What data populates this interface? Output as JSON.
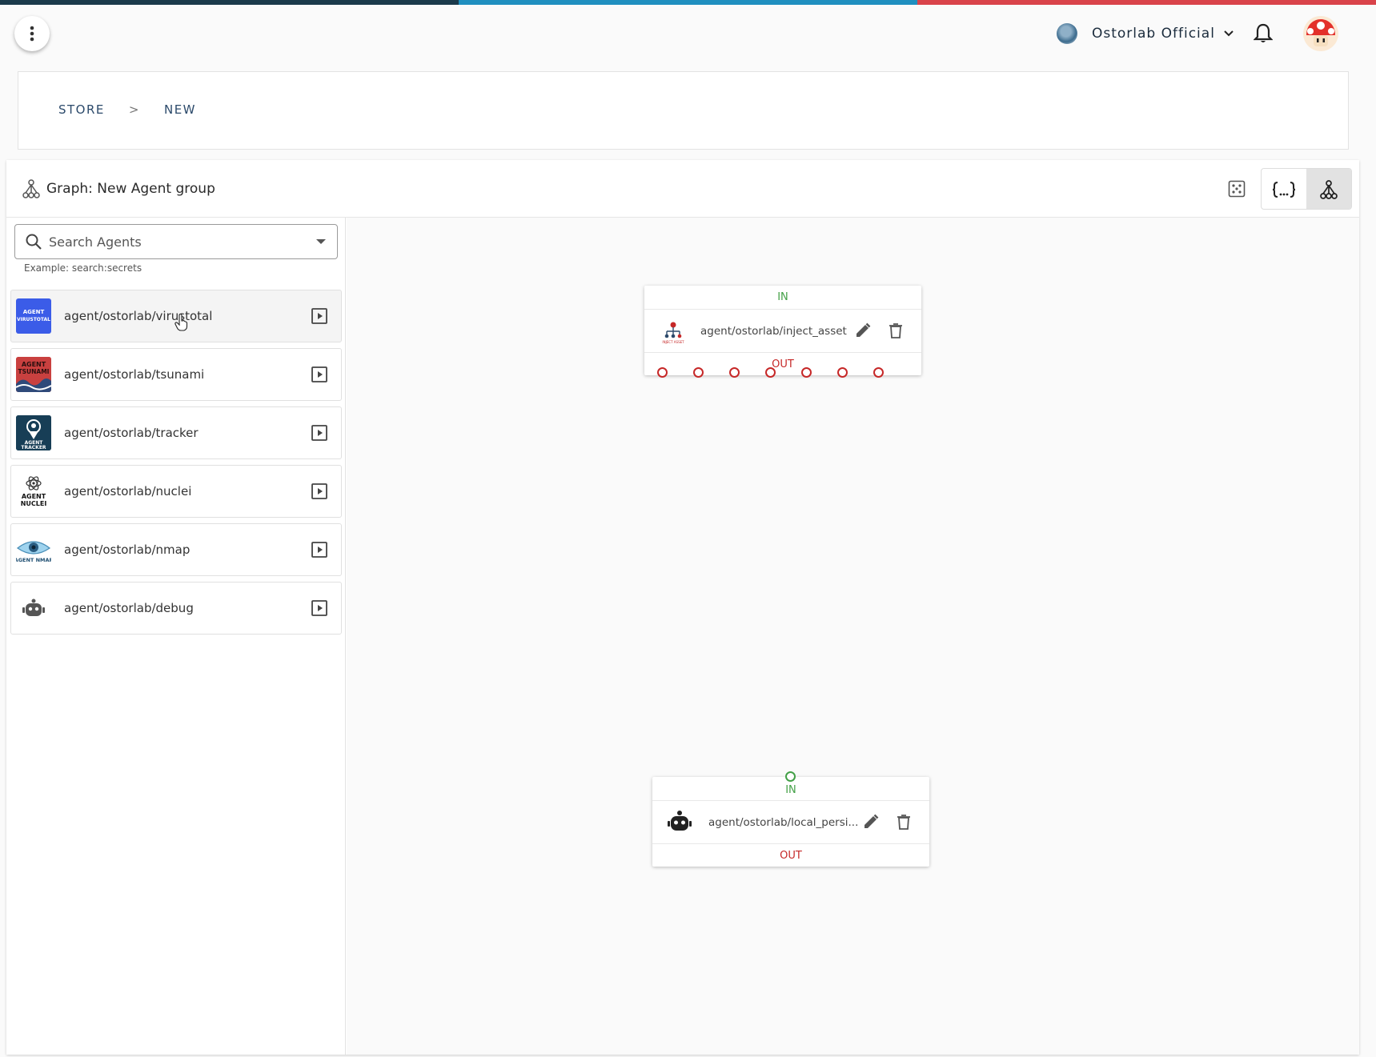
{
  "colors": {
    "strip": [
      "#1b3a4b",
      "#1f8fbf",
      "#d9434a"
    ],
    "in": "#43a047",
    "out": "#c62828"
  },
  "header": {
    "org_name": "Ostorlab Official",
    "menu_icon": "more-vert-icon",
    "bell_icon": "bell-icon",
    "avatar": "mushroom-avatar"
  },
  "breadcrumb": {
    "items": [
      "STORE",
      "NEW"
    ],
    "separator": ">"
  },
  "graph": {
    "title": "Graph: New Agent group",
    "toolbar": [
      "fit-view-icon",
      "json-view-icon",
      "graph-view-icon"
    ]
  },
  "search": {
    "placeholder": "Search Agents",
    "hint": "Example: search:secrets"
  },
  "agents": [
    {
      "name": "agent/ostorlab/virustotal",
      "logo_text": "AGENT\nVIRUSTOTAL",
      "logo_color": "#3b5ce8"
    },
    {
      "name": "agent/ostorlab/tsunami",
      "logo_text": "AGENT\nTSUNAMI",
      "logo_color": "#c9403f"
    },
    {
      "name": "agent/ostorlab/tracker",
      "logo_text": "AGENT\nTRACKER",
      "logo_color": "#173e56"
    },
    {
      "name": "agent/ostorlab/nuclei",
      "logo_text": "AGENT\nNUCLEI",
      "logo_color": "#ffffff"
    },
    {
      "name": "agent/ostorlab/nmap",
      "logo_text": "AGENT NMAP",
      "logo_color": "#ffffff"
    },
    {
      "name": "agent/ostorlab/debug",
      "logo_text": "",
      "logo_color": "#ffffff"
    }
  ],
  "nodes": {
    "inject": {
      "in_label": "IN",
      "name": "agent/ostorlab/inject_asset",
      "out_label": "OUT",
      "out_port_count": 7
    },
    "persist": {
      "in_label": "IN",
      "name": "agent/ostorlab/local_persi...",
      "out_label": "OUT"
    }
  }
}
